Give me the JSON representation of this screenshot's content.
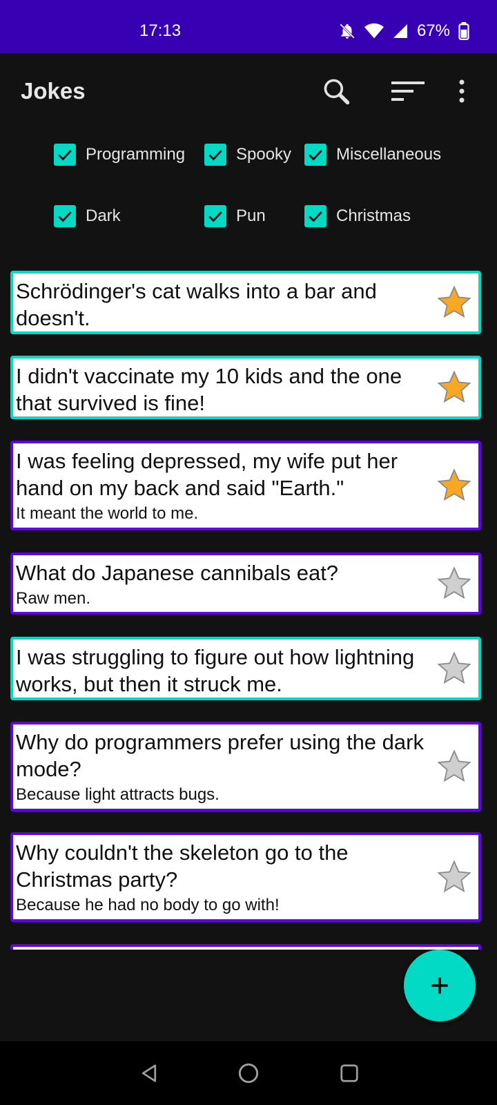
{
  "status_bar": {
    "time": "17:13",
    "battery": "67%"
  },
  "app_bar": {
    "title": "Jokes",
    "icons": [
      "search-icon",
      "sort-icon",
      "more-vert-icon"
    ]
  },
  "filters": [
    {
      "label": "Programming",
      "checked": true
    },
    {
      "label": "Spooky",
      "checked": true
    },
    {
      "label": "Miscellaneous",
      "checked": true
    },
    {
      "label": "Dark",
      "checked": true
    },
    {
      "label": "Pun",
      "checked": true
    },
    {
      "label": "Christmas",
      "checked": true
    }
  ],
  "jokes": [
    {
      "setup": "Schrödinger's cat walks into a bar and doesn't.",
      "delivery": "",
      "favorite": true,
      "type": "single"
    },
    {
      "setup": "I didn't vaccinate my 10 kids and the one that survived is fine!",
      "delivery": "",
      "favorite": true,
      "type": "single"
    },
    {
      "setup": "I was feeling depressed, my wife put her hand on my back and said \"Earth.\"",
      "delivery": "It meant the world to me.",
      "favorite": true,
      "type": "twopart"
    },
    {
      "setup": "What do Japanese cannibals eat?",
      "delivery": "Raw men.",
      "favorite": false,
      "type": "twopart"
    },
    {
      "setup": "I was struggling to figure out how lightning works, but then it struck me.",
      "delivery": "",
      "favorite": false,
      "type": "single"
    },
    {
      "setup": "Why do programmers prefer using the dark mode?",
      "delivery": "Because light attracts bugs.",
      "favorite": false,
      "type": "twopart"
    },
    {
      "setup": "Why couldn't the skeleton go to the Christmas party?",
      "delivery": "Because he had no body to go with!",
      "favorite": false,
      "type": "twopart"
    }
  ],
  "fab": {
    "icon": "add-icon"
  },
  "colors": {
    "status_bar": "#3700B3",
    "accent": "#03DAC5",
    "twopart_border": "#6200EE",
    "background": "#121212"
  }
}
